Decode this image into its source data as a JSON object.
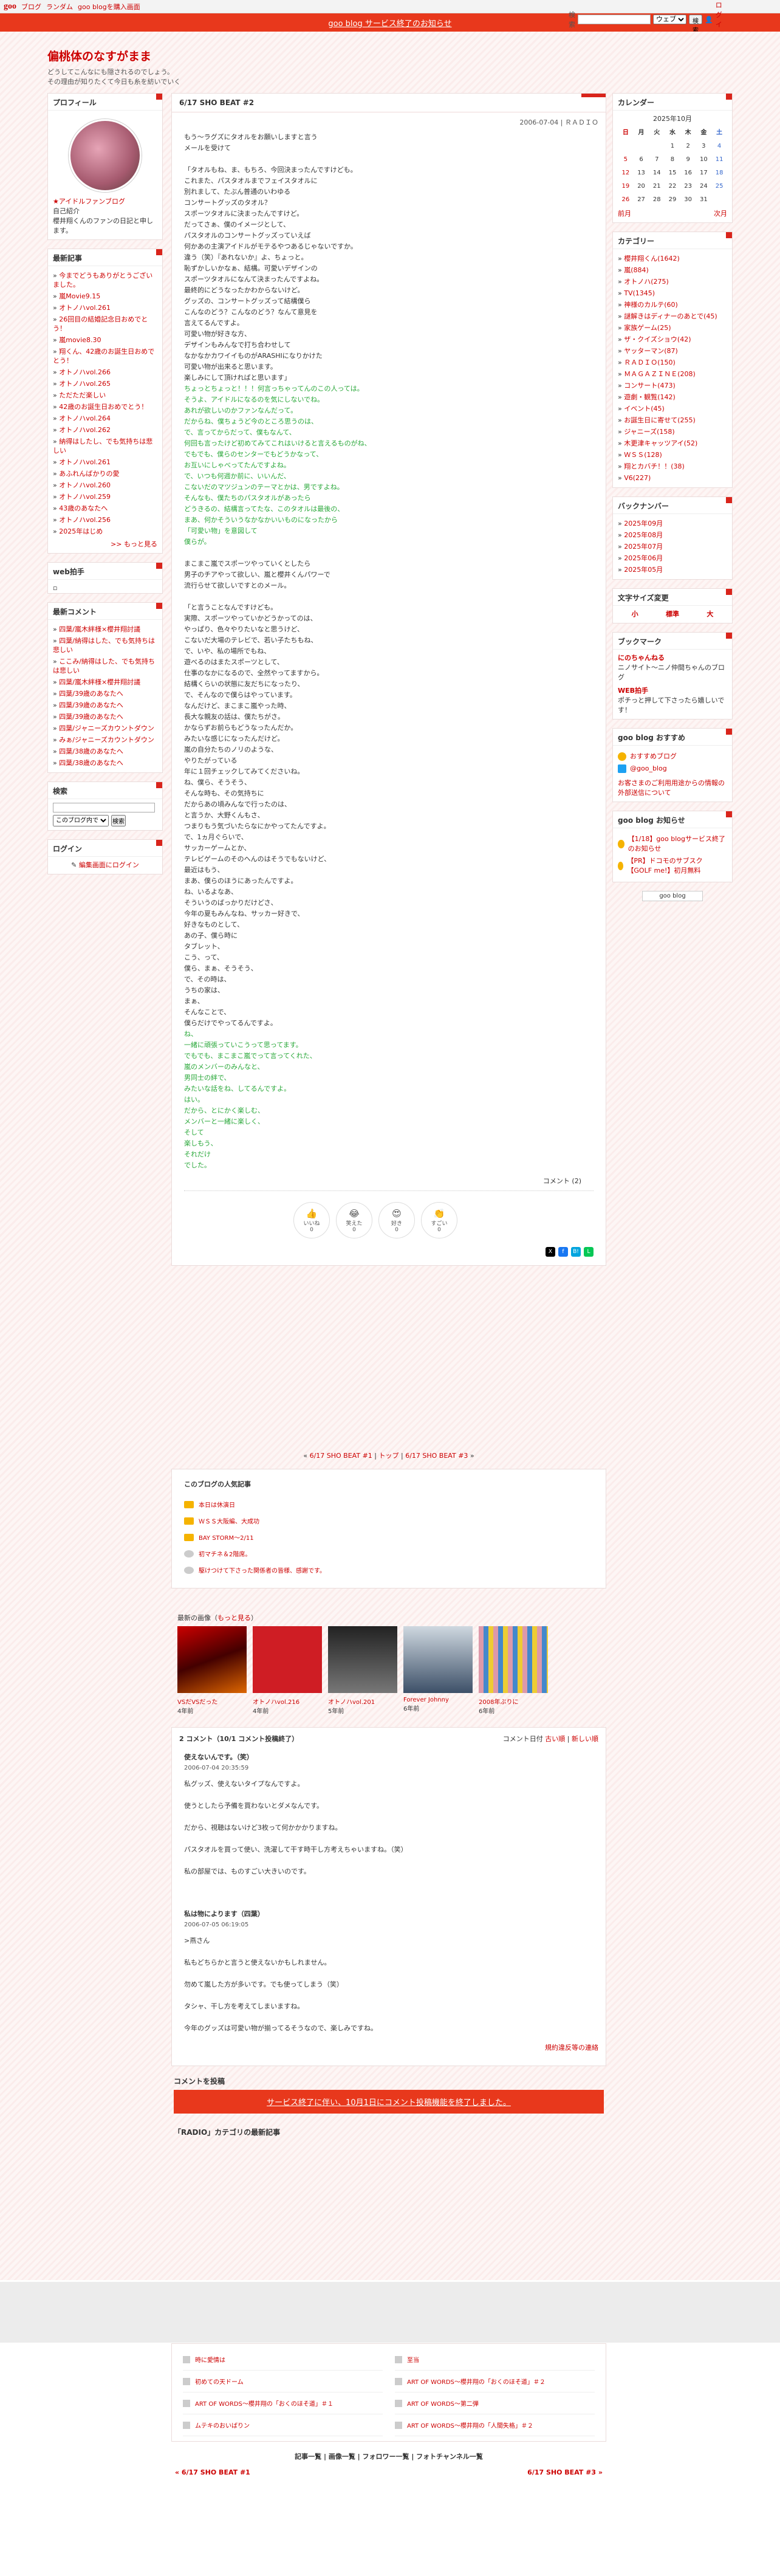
{
  "topbar": {
    "logo": "goo",
    "links": [
      "ブログ",
      "ランダム",
      "goo blogを購入画面"
    ],
    "search_label": "検索",
    "search_select": "ウェブ",
    "search_button": "検索",
    "login": "ログイン"
  },
  "banner": "goo blog サービス終了のお知らせ",
  "blog": {
    "title": "偏桃体のなすがまま",
    "desc": "どうしてこんなにも隠されるのでしょう。\nその理由が知りたくて今日も糸を紡いでいく"
  },
  "left": {
    "profile_title": "プロフィール",
    "profile_name": "★アイドルファンブログ",
    "profile_label": "自己紹介",
    "profile_text": "櫻井翔くんのファンの日記と申します。",
    "recent_title": "最新記事",
    "recent_items": [
      "今までどうもありがとうございました。",
      "嵐Movie9.15",
      "オトノハvol.261",
      "26回目の結婚記念日おめでとう！",
      "嵐movie8.30",
      "翔くん、42歳のお誕生日おめでとう！",
      "オトノハvol.266",
      "オトノハvol.265",
      "ただただ楽しい",
      "42歳のお誕生日おめでとう！",
      "オトノハvol.264",
      "オトノハvol.262",
      "納得はしたし、でも気持ちは悲しい",
      "オトノハvol.261",
      "あふれんばかりの愛",
      "オトノハvol.260",
      "オトノハvol.259",
      "43歳のあなたへ",
      "オトノハvol.256",
      "2025年はじめ"
    ],
    "more": ">> もっと見る",
    "web_title": "web拍手",
    "comment_title": "最新コメント",
    "comment_items": [
      "四葉/嵐木絆様×櫻井翔討議",
      "四葉/納得はした、でも気持ちは悲しい",
      "ここみ/納得はした、でも気持ちは悲しい",
      "四葉/嵐木絆様×櫻井翔討議",
      "四葉/39歳のあなたへ",
      "四葉/39歳のあなたへ",
      "四葉/39歳のあなたへ",
      "四葉/ジャニーズカウントダウン",
      "みぁ/ジャニーズカウントダウン",
      "四葉/38歳のあなたへ",
      "四葉/38歳のあなたへ"
    ],
    "search_title": "検索",
    "search_select": "このブログ内で",
    "search_button": "検索",
    "login_title": "ログイン",
    "login_link": "編集画面にログイン"
  },
  "article": {
    "title": "6/17 SHO BEAT #2",
    "meta": "2006-07-04 | ＲＡＤＩＯ",
    "body1": "もう〜ラグズにタオルをお願いしますと言う\nメールを受けて\n\n「タオルもね、ま、もちろ、今回決まったんですけども。\nこれまた、パスタオルまでフェイスタオルに\n別れまして、たぶん普通のいわゆる\nコンサートグッズのタオル？\nスポーツタオルに決まったんですけど。\nだってさぁ、僕のイメージとして、\nパスタオルのコンサートグッズっていえば\n何かあの主演アイドルがモテるやつあるじゃないですか。\n違う（笑）『あれないか』よ、ちょっと。\n恥ずかしいかなぁ、結構。可愛いデザインの\nスポーツタオルになんて決まったんですよね。\n最終的にどうなったかわからないけど。\nグッズの、コンサートグッズって結構僕ら\nこんなのどう？こんなのどう？なんて意見を\n言えてるんですよ。\n可愛い物が好きな方、\nデザインもみんなで打ち合わせして\nなかなかカワイイものがARASHIになりかけた\n可愛い物が出来ると思います。\n楽しみにして頂ければと思います」",
    "body_green": "ちょっとちょっと！！！何言っちゃってんのこの人っては。\nそうよ、アイドルになるのを気にしないでね。\nあれが欲しいのかファンなんだって。\nだからね、僕ちょうど今のところ思うのは、\nで、言ってからだって、僕もなんて、\n何回も言ったけど初めてみてこれはいけると言えるものがね、\nでもでも、僕らのセンターでもどうかなって、\nお互いにしゃべってたんですよね。\nで、いつも何週か前に、いいんだ、\nこないだのマツジュンのテーマとかは、男ですよね。\nそんなも、僕たちのパスタオルがあったら\nどうきるの、結構言ってたな、このタオルは最後の、\nまあ、何かそういうなかなかいいものになったから\n「可愛い物」を意図して\n僕らが。",
    "body2": "まこまこ嵐でスポーツやっていくとしたら\n男子のチアやって欲しい、嵐と櫻井くんパワーで\n流行らせて欲しいですとのメール。\n\n「と言うことなんですけども。\n実際、スポーツやっていかどうかってのは、\nやっぱり、色々やりたいなと思うけど、\nこないだ大場のテレビで、若い子たちもね、\nで、いや、私の場所でもね、\n遊べるのはまたスポーツとして、\n仕事のなかになるので、全然やってますから。\n結構くらいの状態に友だちになったり、\nで、そんなので僕らはやっています。\nなんだけど、まこまこ嵐やった時、\n長大な親友の話は、僕たちがさ。\nかならずお前らもどうなったんだか。\nみたいな感じになったんだけど。\n嵐の自分たちのノリのような、\nやりたがっている\n年に１回チェックしてみてくださいね。\nね、僕ら、そうそう、\nそんな時も、その気持ちに\nだからあの頃みんなで行ったのは、\nと言うか、大野くんもさ、\nつまりもう気づいたらなにかやってたんですよ。\nで、1ヵ月ぐらいで、\nサッカーゲームとか、\nテレビゲームのそのへんのはそうでもないけど、\n最近はもう、\nまあ、僕らのほうにあったんですよ。\nね、いるよなあ、\nそういうのばっかりだけどさ、\n今年の夏もみんなね、サッカー好きで、\n好きなものとして、\nあの子、僕ら時に\nタブレット、\nこう、って、\n僕ら、まぁ、そうそう、\nで、その時は、\nうちの家は、\nまぁ、\nそんなことで、\n僕らだけでやってるんですよ。",
    "body_green2": "ね、\n一緒に頑張っていこうって思ってます。\nでもでも、まこまこ嵐でって言ってくれた、\n嵐のメンバーのみんなと、\n男同士の絆で、\nみたいな話をね、してるんですよ。\nはい。\nだから、とにかく楽しむ、\nメンバーと一緒に楽しく、\nそして\n楽しもう、\nそれだけ\nでした。",
    "comment_count": "コメント (2)",
    "reactions": [
      {
        "emoji": "👍",
        "label": "いいね",
        "count": "0"
      },
      {
        "emoji": "😂",
        "label": "笑えた",
        "count": "0"
      },
      {
        "emoji": "😍",
        "label": "好き",
        "count": "0"
      },
      {
        "emoji": "👏",
        "label": "すごい",
        "count": "0"
      }
    ]
  },
  "nav": {
    "prev": "6/17 SHO BEAT #1",
    "top": "トップ",
    "next": "6/17 SHO BEAT #3"
  },
  "popular": {
    "title": "このブログの人気記事",
    "items": [
      "本日は休演日",
      "ＷＳＳ大阪編、大成功",
      "BAY STORM〜2/11",
      "初マチネ＆2階席。",
      "駆けつけて下さった関係者の皆様、感謝です。"
    ]
  },
  "images": {
    "title": "最新の画像",
    "more": "もっと見る",
    "items": [
      {
        "label": "VSだVSだった",
        "age": "4年前"
      },
      {
        "label": "オトノハvol.216",
        "age": "4年前"
      },
      {
        "label": "オトノハvol.201",
        "age": "5年前"
      },
      {
        "label": "Forever Johnny",
        "age": "6年前"
      },
      {
        "label": "2008年ぶりに",
        "age": "6年前"
      }
    ]
  },
  "comments": {
    "title": "2 コメント（10/1 コメント投稿終了）",
    "sort": "コメント日付",
    "old": "古い順",
    "new": "新しい順",
    "items": [
      {
        "who": "使えないんです。（笑）",
        "date": "2006-07-04 20:35:59",
        "text": "私グッズ、使えないタイプなんですよ。\n\n使うとしたら予備を買わないとダメなんです。\n\nだから、視聴はないけど3枚って何かかかりますね。\n\nパスタオルを買って使い、洗濯して干す時干し方考えちゃいますね。（笑）\n\n私の部屋では、ものすごい大きいのです。"
      },
      {
        "who": "私は物によります（四葉）",
        "date": "2006-07-05 06:19:05",
        "text": ">燕さん\n\n私もどちらかと言うと使えないかもしれません。\n\n勿めて嵐した方が多いです。でも使ってしまう（笑）\n\nタシャ、干し方を考えてしまいますね。\n\n今年のグッズは可愛い物が揃ってるそうなので、楽しみですね。"
      }
    ],
    "guide": "規約違反等の連絡"
  },
  "post_comment_title": "コメントを投稿",
  "end_banner": "サービス終了に伴い、10月1日にコメント投稿機能を終了しました。",
  "category_title": "「RADIO」カテゴリの最新記事",
  "related": [
    "時に愛情は",
    "至当",
    "初めての天ドーム",
    "ART OF WORDS〜櫻井翔の「おくのほそ道」＃２",
    "ART OF WORDS〜櫻井翔の「おくのほそ道」＃１",
    "ART OF WORDS〜第二弾",
    "ムテキのおいばりン",
    "ART OF WORDS〜櫻井翔の「人間失格」＃２"
  ],
  "footer": {
    "links": "記事一覧 | 画像一覧 | フォロワー一覧 | フォトチャンネル一覧",
    "prev": "« 6/17 SHO BEAT #1",
    "next": "6/17 SHO BEAT #3 »"
  },
  "right": {
    "calendar_title": "カレンダー",
    "calendar_month": "2025年10月",
    "weekdays": [
      "日",
      "月",
      "火",
      "水",
      "木",
      "金",
      "土"
    ],
    "weeks": [
      [
        "",
        "",
        "",
        "1",
        "2",
        "3",
        "4"
      ],
      [
        "5",
        "6",
        "7",
        "8",
        "9",
        "10",
        "11"
      ],
      [
        "12",
        "13",
        "14",
        "15",
        "16",
        "17",
        "18"
      ],
      [
        "19",
        "20",
        "21",
        "22",
        "23",
        "24",
        "25"
      ],
      [
        "26",
        "27",
        "28",
        "29",
        "30",
        "31",
        ""
      ]
    ],
    "cal_prev": "前月",
    "cal_next": "次月",
    "category_title": "カテゴリー",
    "categories": [
      "櫻井翔くん(1642)",
      "嵐(884)",
      "オトノハ(275)",
      "TV(1345)",
      "神様のカルテ(60)",
      "謎解きはディナーのあとで(45)",
      "家族ゲーム(25)",
      "ザ・クイズショウ(42)",
      "ヤッターマン(87)",
      "ＲＡＤＩＯ(150)",
      "ＭＡＧＡＺＩＮＥ(208)",
      "コンサート(473)",
      "遊劇・観覧(142)",
      "イベント(45)",
      "お誕生日に寄せて(255)",
      "ジャニーズ(158)",
      "木更津キャッツアイ(52)",
      "ＷＳＳ(128)",
      "翔とカバチ！！(38)",
      "V6(227)"
    ],
    "backnumber_title": "バックナンバー",
    "backnumbers": [
      "2025年09月",
      "2025年08月",
      "2025年07月",
      "2025年06月",
      "2025年05月"
    ],
    "fontsize_title": "文字サイズ変更",
    "fontsize": [
      "小",
      "標準",
      "大"
    ],
    "bookmark_title": "ブックマーク",
    "bookmarks": [
      {
        "name": "にのちゃんねる",
        "desc": "ニノサイト〜ニノ仲間ちゃんのブログ"
      },
      {
        "name": "WEB拍手",
        "desc": "ポチっと押して下さったら嬉しいです！"
      }
    ],
    "goo_title": "goo blog おすすめ",
    "goo_items": [
      "おすすめブログ",
      "@goo_blog"
    ],
    "goo_notice": "お客さまのご利用用途からの情報の外部送信について",
    "news_title": "goo blog お知らせ",
    "news": [
      "【1/18】goo blogサービス終了のお知らせ",
      "【PR】ドコモのサブスク【GOLF me!】初月無料"
    ],
    "badge": "goo blog"
  }
}
